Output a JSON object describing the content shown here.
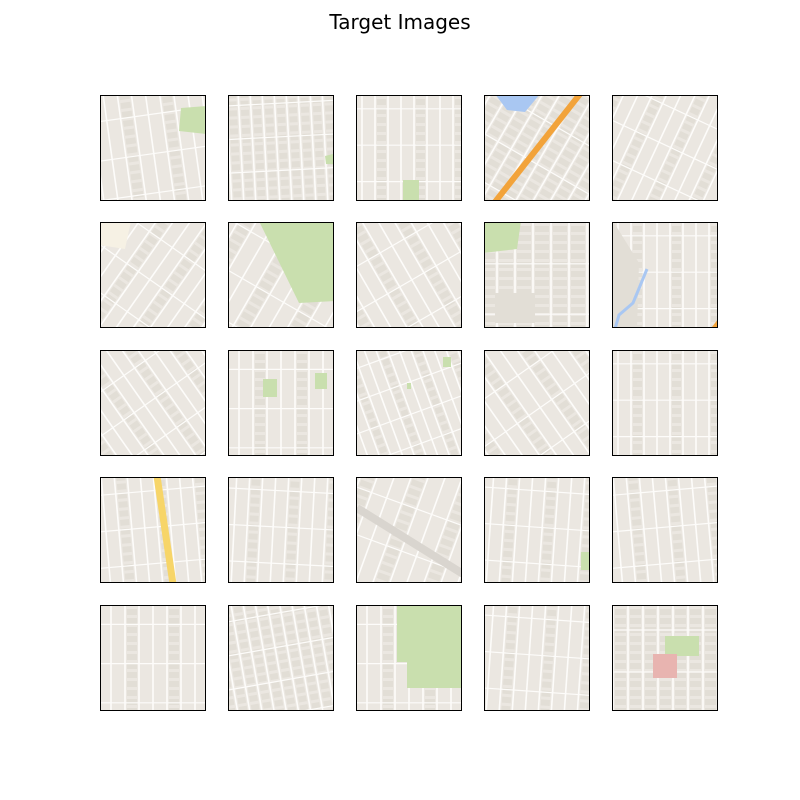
{
  "figure": {
    "title": "Target Images"
  },
  "colors": {
    "land": "#ebe7e1",
    "block": "#e2ded6",
    "road": "#fdfcfa",
    "park": "#c9dfae",
    "water": "#a9c7f2",
    "highway_orange": "#f2a33a",
    "highway_yellow": "#f7d568",
    "sand": "#f6f1e4",
    "building_red": "#e8b4b0",
    "frame": "#000000"
  },
  "tiles": [
    {
      "features": [
        "grid-streets",
        "park"
      ]
    },
    {
      "features": [
        "grid-streets",
        "park"
      ]
    },
    {
      "features": [
        "grid-streets",
        "park"
      ]
    },
    {
      "features": [
        "diagonal-streets",
        "water",
        "highway"
      ]
    },
    {
      "features": [
        "diagonal-streets"
      ]
    },
    {
      "features": [
        "diagonal-streets",
        "sand-area"
      ]
    },
    {
      "features": [
        "diagonal-streets",
        "park"
      ]
    },
    {
      "features": [
        "diagonal-streets"
      ]
    },
    {
      "features": [
        "grid-streets",
        "park",
        "large-lots"
      ]
    },
    {
      "features": [
        "grid-streets",
        "water",
        "highway"
      ]
    },
    {
      "features": [
        "diagonal-streets"
      ]
    },
    {
      "features": [
        "grid-streets",
        "park"
      ]
    },
    {
      "features": [
        "irregular-streets",
        "park"
      ]
    },
    {
      "features": [
        "diagonal-streets"
      ]
    },
    {
      "features": [
        "grid-streets"
      ]
    },
    {
      "features": [
        "grid-streets",
        "highway"
      ]
    },
    {
      "features": [
        "grid-streets"
      ]
    },
    {
      "features": [
        "irregular-streets",
        "rail"
      ]
    },
    {
      "features": [
        "grid-streets",
        "park"
      ]
    },
    {
      "features": [
        "grid-streets"
      ]
    },
    {
      "features": [
        "grid-streets"
      ]
    },
    {
      "features": [
        "irregular-streets"
      ]
    },
    {
      "features": [
        "grid-streets",
        "park"
      ]
    },
    {
      "features": [
        "grid-streets"
      ]
    },
    {
      "features": [
        "grid-streets",
        "park",
        "red-buildings"
      ]
    }
  ]
}
